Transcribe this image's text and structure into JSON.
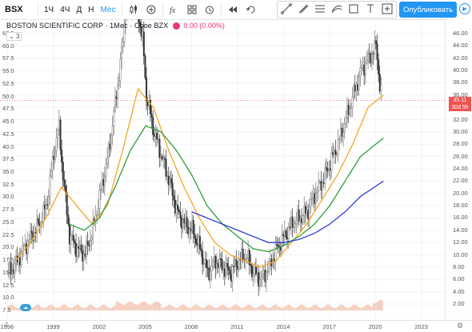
{
  "toolbar": {
    "symbol": "BSX",
    "intervals": [
      "1Ч",
      "4Ч",
      "Д",
      "Н",
      "Мес"
    ],
    "active_interval": "Мес",
    "publish_label": "Опубликовать"
  },
  "legend": {
    "title": "BOSTON SCIENTIFIC CORP · 1Мес · Cboe BZX",
    "value": "0.00 (0.00%)",
    "collapse_label": "3"
  },
  "colors": {
    "up": "#26a69a",
    "down": "#ef5350",
    "candle": "#555555",
    "ma_orange": "#f5a623",
    "ma_green": "#2e9e3a",
    "ma_blue": "#2f3bd6",
    "volume": "#f3c9b8",
    "accent": "#2196f3"
  },
  "price_tags": {
    "last": "35.11",
    "countdown": "30d 5h"
  },
  "right_axis_labels": [
    "46.00",
    "44.00",
    "42.00",
    "40.00",
    "38.00",
    "36.00",
    "34.00",
    "32.00",
    "30.00",
    "28.00",
    "26.00",
    "24.00",
    "22.00",
    "20.00",
    "18.00",
    "16.00",
    "14.00",
    "12.00",
    "10.00",
    "8.00",
    "6.00",
    "4.00",
    "2.00"
  ],
  "left_axis_labels": [
    "62.5",
    "60.0",
    "57.5",
    "55.0",
    "52.5",
    "50.0",
    "47.5",
    "45.0",
    "42.5",
    "40.0",
    "37.5",
    "35.0",
    "32.5",
    "30.0",
    "27.5",
    "25.0",
    "22.5",
    "20.0",
    "17.5",
    "15.0",
    "12.5",
    "10.0",
    "7.5"
  ],
  "x_axis_labels": [
    "1996",
    "1999",
    "2002",
    "2005",
    "2008",
    "2011",
    "2014",
    "2017",
    "2020",
    "2023"
  ],
  "chart_data": {
    "type": "line",
    "title": "BOSTON SCIENTIFIC CORP · 1Мес · Cboe BZX",
    "x_range": [
      1995.5,
      2024.5
    ],
    "ylim_left": [
      7.5,
      62.5
    ],
    "ylim_right": [
      2,
      46
    ],
    "series": [
      {
        "name": "",
        "points": [
          [
            1996,
            7
          ],
          [
            1996.5,
            8.5
          ],
          [
            1997,
            11
          ],
          [
            1997.5,
            13
          ],
          [
            1998,
            15
          ],
          [
            1998.5,
            18
          ],
          [
            1999,
            27
          ],
          [
            1999.3,
            31
          ],
          [
            1999.6,
            22
          ],
          [
            2000,
            13
          ],
          [
            2000.5,
            11
          ],
          [
            2001,
            10
          ],
          [
            2001.5,
            14
          ],
          [
            2002,
            20
          ],
          [
            2002.5,
            26
          ],
          [
            2003,
            35
          ],
          [
            2003.5,
            45
          ],
          [
            2003.8,
            57
          ],
          [
            2004,
            60
          ],
          [
            2004.3,
            52
          ],
          [
            2004.8,
            44
          ],
          [
            2005,
            36
          ],
          [
            2005.5,
            30
          ],
          [
            2006,
            26
          ],
          [
            2006.5,
            22
          ],
          [
            2007,
            17
          ],
          [
            2007.5,
            15
          ],
          [
            2008,
            14
          ],
          [
            2008.5,
            11
          ],
          [
            2009,
            7
          ],
          [
            2009.5,
            9
          ],
          [
            2010,
            8
          ],
          [
            2010.5,
            7
          ],
          [
            2011,
            9
          ],
          [
            2011.5,
            10
          ],
          [
            2012,
            7
          ],
          [
            2012.5,
            6
          ],
          [
            2013,
            8
          ],
          [
            2013.5,
            11
          ],
          [
            2014,
            13
          ],
          [
            2014.5,
            15
          ],
          [
            2015,
            16
          ],
          [
            2015.5,
            17
          ],
          [
            2016,
            20
          ],
          [
            2016.5,
            22
          ],
          [
            2017,
            25
          ],
          [
            2017.5,
            28
          ],
          [
            2018,
            32
          ],
          [
            2018.5,
            36
          ],
          [
            2019,
            40
          ],
          [
            2019.5,
            42
          ],
          [
            2020,
            44
          ],
          [
            2020.2,
            38
          ],
          [
            2020.4,
            35
          ]
        ]
      },
      {
        "name": "",
        "points": [
          [
            1996.5,
            9
          ],
          [
            1997.5,
            12
          ],
          [
            1998.5,
            16
          ],
          [
            1999.5,
            21
          ],
          [
            2000.5,
            18
          ],
          [
            2001.5,
            15
          ],
          [
            2002.5,
            18
          ],
          [
            2003.5,
            27
          ],
          [
            2004.5,
            37
          ],
          [
            2005.5,
            34
          ],
          [
            2006.5,
            27
          ],
          [
            2007.5,
            21
          ],
          [
            2008.5,
            16
          ],
          [
            2009.5,
            12
          ],
          [
            2010.5,
            10
          ],
          [
            2011.5,
            9
          ],
          [
            2012.5,
            8
          ],
          [
            2013.5,
            9
          ],
          [
            2014.5,
            12
          ],
          [
            2015.5,
            15
          ],
          [
            2016.5,
            19
          ],
          [
            2017.5,
            23
          ],
          [
            2018.5,
            28
          ],
          [
            2019.5,
            34
          ],
          [
            2020.5,
            36
          ]
        ]
      },
      {
        "name": "",
        "points": [
          [
            2000,
            15
          ],
          [
            2001,
            14
          ],
          [
            2002,
            16
          ],
          [
            2003,
            21
          ],
          [
            2004,
            27
          ],
          [
            2005,
            31
          ],
          [
            2006,
            30
          ],
          [
            2007,
            27
          ],
          [
            2008,
            23
          ],
          [
            2009,
            18
          ],
          [
            2010,
            15
          ],
          [
            2011,
            13
          ],
          [
            2012,
            11
          ],
          [
            2013,
            10.5
          ],
          [
            2014,
            11.5
          ],
          [
            2015,
            13
          ],
          [
            2016,
            15
          ],
          [
            2017,
            18
          ],
          [
            2018,
            22
          ],
          [
            2019,
            26
          ],
          [
            2020.5,
            29
          ]
        ]
      },
      {
        "name": "",
        "points": [
          [
            2008,
            17
          ],
          [
            2009,
            16
          ],
          [
            2010,
            15
          ],
          [
            2011,
            14
          ],
          [
            2012,
            13
          ],
          [
            2013,
            12
          ],
          [
            2014,
            12
          ],
          [
            2015,
            12.5
          ],
          [
            2016,
            13.5
          ],
          [
            2017,
            15
          ],
          [
            2018,
            17
          ],
          [
            2019,
            19.5
          ],
          [
            2020.5,
            22
          ]
        ]
      }
    ],
    "grid": true
  }
}
